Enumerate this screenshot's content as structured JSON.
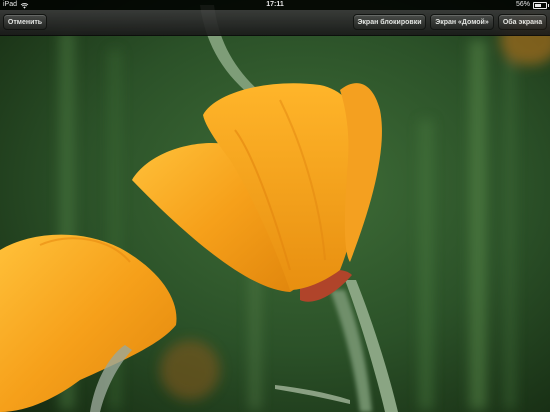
{
  "status_bar": {
    "device": "iPad",
    "time": "17:11",
    "battery": "56%",
    "battery_level": 0.56
  },
  "toolbar": {
    "cancel_label": "Отменить",
    "lock_screen_label": "Экран блокировки",
    "home_screen_label": "Экран «Домой»",
    "both_screens_label": "Оба экрана"
  },
  "colors": {
    "toolbar": "#2a2a2a",
    "poppy_orange": "#f7a21a",
    "background_green": "#2f5a2c"
  },
  "icons": [
    "wifi-icon",
    "battery-icon"
  ]
}
